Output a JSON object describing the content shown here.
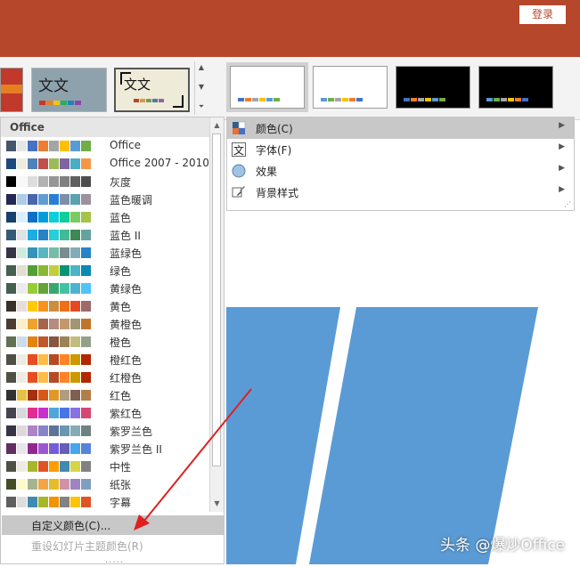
{
  "header": {
    "login_label": "登录"
  },
  "ribbon": {
    "theme_thumbnails": [
      {
        "name": "theme-partial",
        "text": ""
      },
      {
        "name": "theme-wenwen-blue",
        "text": "文文"
      },
      {
        "name": "theme-wenwen-beige",
        "text": "文文"
      }
    ],
    "variant_colors": [
      {
        "bg": "#ffffff",
        "bar": [
          "#4472c4",
          "#ed7d31",
          "#a5a5a5",
          "#ffc000",
          "#5b9bd5",
          "#70ad47"
        ]
      },
      {
        "bg": "#ffffff",
        "bar": [
          "#5b9bd5",
          "#70ad47",
          "#a5a5a5",
          "#ffc000",
          "#ed7d31",
          "#4472c4"
        ]
      },
      {
        "bg": "#000000",
        "bar": [
          "#4472c4",
          "#ed7d31",
          "#a5a5a5",
          "#ffc000",
          "#5b9bd5",
          "#70ad47"
        ]
      },
      {
        "bg": "#000000",
        "bar": [
          "#5b9bd5",
          "#70ad47",
          "#a5a5a5",
          "#ffc000",
          "#ed7d31",
          "#4472c4"
        ]
      }
    ]
  },
  "colors_dropdown": {
    "header": "Office",
    "items": [
      {
        "name": "Office",
        "swatches": [
          "#44546a",
          "#e7e6e6",
          "#4472c4",
          "#ed7d31",
          "#a5a5a5",
          "#ffc000",
          "#5b9bd5",
          "#70ad47"
        ]
      },
      {
        "name": "Office 2007 - 2010",
        "swatches": [
          "#1f497d",
          "#eeece1",
          "#4f81bd",
          "#c0504d",
          "#9bbb59",
          "#8064a2",
          "#4bacc6",
          "#f79646"
        ]
      },
      {
        "name": "灰度",
        "swatches": [
          "#000000",
          "#f8f8f8",
          "#dddddd",
          "#b2b2b2",
          "#969696",
          "#808080",
          "#5f5f5f",
          "#4d4d4d"
        ]
      },
      {
        "name": "蓝色暖调",
        "swatches": [
          "#242852",
          "#acccea",
          "#4a66ac",
          "#629dd1",
          "#297fd5",
          "#7f8fa9",
          "#5aa2ae",
          "#9d90a0"
        ]
      },
      {
        "name": "蓝色",
        "swatches": [
          "#17406d",
          "#dbefff",
          "#0f6fc6",
          "#009dd9",
          "#0bd0d9",
          "#10cf9b",
          "#7cca62",
          "#a5c249"
        ]
      },
      {
        "name": "蓝色 II",
        "swatches": [
          "#335b74",
          "#dfe3e5",
          "#1cade4",
          "#2683c6",
          "#27ced7",
          "#42ba97",
          "#3e8853",
          "#62a39f"
        ]
      },
      {
        "name": "蓝绿色",
        "swatches": [
          "#373545",
          "#ceeddd",
          "#3494ba",
          "#58b6c0",
          "#75bda7",
          "#7a8c8e",
          "#84acb6",
          "#2683c6"
        ]
      },
      {
        "name": "绿色",
        "swatches": [
          "#455f51",
          "#e3ded1",
          "#549e39",
          "#8ab833",
          "#c0cf3a",
          "#029676",
          "#4ab5c4",
          "#0989b1"
        ]
      },
      {
        "name": "黄绿色",
        "swatches": [
          "#455f51",
          "#ebebeb",
          "#99cb38",
          "#63a537",
          "#37a76f",
          "#44c1a3",
          "#4eb3cf",
          "#51c3f9"
        ]
      },
      {
        "name": "黄色",
        "swatches": [
          "#39302a",
          "#e5dedb",
          "#ffca08",
          "#f8931d",
          "#ce8d3e",
          "#ec7016",
          "#e64823",
          "#9c6a6a"
        ]
      },
      {
        "name": "黄橙色",
        "swatches": [
          "#4e3b30",
          "#fbeec9",
          "#f0a22e",
          "#a5644e",
          "#b58b80",
          "#c3986d",
          "#a19574",
          "#c17529"
        ]
      },
      {
        "name": "橙色",
        "swatches": [
          "#637052",
          "#ccddea",
          "#e48312",
          "#bd582c",
          "#865640",
          "#9b8357",
          "#c2bc80",
          "#94a088"
        ]
      },
      {
        "name": "橙红色",
        "swatches": [
          "#505046",
          "#eeece1",
          "#e84c22",
          "#ffbd47",
          "#b64926",
          "#ff8427",
          "#cc9900",
          "#b22600"
        ]
      },
      {
        "name": "红橙色",
        "swatches": [
          "#505046",
          "#eeece1",
          "#e84c22",
          "#ffbd47",
          "#b64926",
          "#ff8427",
          "#cc9900",
          "#b22600"
        ]
      },
      {
        "name": "红色",
        "swatches": [
          "#323232",
          "#e5c243",
          "#a5300f",
          "#d55816",
          "#e19825",
          "#b19c7d",
          "#7f5f52",
          "#b27d49"
        ]
      },
      {
        "name": "紫红色",
        "swatches": [
          "#454551",
          "#d8d9dc",
          "#e32d91",
          "#c830cc",
          "#4ea6dc",
          "#4775e7",
          "#8971e1",
          "#d54773"
        ]
      },
      {
        "name": "紫罗兰色",
        "swatches": [
          "#373545",
          "#dcd8dc",
          "#ad84c6",
          "#8784c7",
          "#5d739a",
          "#6997af",
          "#84acb6",
          "#6f8183"
        ]
      },
      {
        "name": "紫罗兰色 II",
        "swatches": [
          "#632e62",
          "#eae5eb",
          "#92278f",
          "#9b57d3",
          "#755dd9",
          "#665eb8",
          "#45a5ed",
          "#5982db"
        ]
      },
      {
        "name": "中性",
        "swatches": [
          "#505046",
          "#eeece1",
          "#a6b727",
          "#df5327",
          "#fe9e00",
          "#418ab3",
          "#d7d447",
          "#818183"
        ]
      },
      {
        "name": "纸张",
        "swatches": [
          "#444d26",
          "#fefac9",
          "#a5b592",
          "#f3a447",
          "#e7bc29",
          "#d092a7",
          "#9c85c0",
          "#809ec2"
        ]
      },
      {
        "name": "字幕",
        "swatches": [
          "#5e5e5e",
          "#dddddd",
          "#418ab3",
          "#a6b727",
          "#f69200",
          "#838383",
          "#fec306",
          "#df5327"
        ]
      }
    ],
    "custom_label": "自定义颜色(C)...",
    "reset_label": "重设幻灯片主题颜色(R)",
    "grip": "....."
  },
  "submenu": {
    "items": [
      {
        "key": "colors",
        "label": "颜色(C)",
        "icon": "colors-icon",
        "active": true
      },
      {
        "key": "fonts",
        "label": "字体(F)",
        "icon": "font-icon",
        "active": false
      },
      {
        "key": "effects",
        "label": "效果",
        "icon": "effects-icon",
        "active": false
      },
      {
        "key": "background",
        "label": "背景样式",
        "icon": "background-style-icon",
        "active": false
      }
    ]
  },
  "watermark": "头条 @爆炒Office"
}
